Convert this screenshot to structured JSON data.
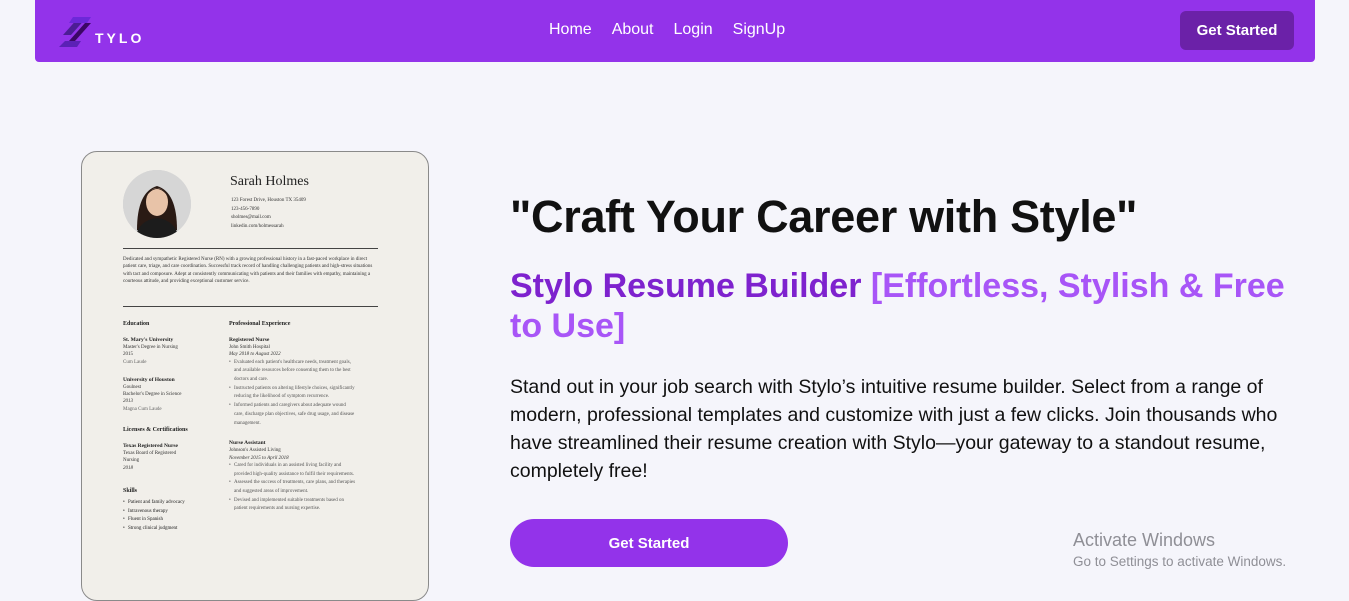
{
  "brand": {
    "name": "TYLO"
  },
  "nav": {
    "links": [
      "Home",
      "About",
      "Login",
      "SignUp"
    ],
    "cta": "Get Started"
  },
  "resume": {
    "name": "Sarah Holmes",
    "contact": [
      "123 Forest Drive, Houston TX 35409",
      "123-456-7890",
      "sholmes@mail.com",
      "linkedin.com/holmessarah"
    ],
    "summary": "Dedicated and sympathetic Registered Nurse (RN) with a growing professional history in a fast-paced workplace in direct patient care, triage, and care coordination. Successful track record of handling challenging patients and high-stress situations with tact and composure. Adept at consistently communicating with patients and their families with empathy, maintaining a courteous attitude, and providing exceptional customer service.",
    "education": {
      "heading": "Education",
      "items": [
        {
          "title": "St. Mary's University",
          "lines": [
            "Master's Degree in Nursing",
            "2015",
            "Cum Laude"
          ]
        },
        {
          "title": "University of Houston",
          "lines": [
            "Goulnest",
            "Bachelor's Degree in Science",
            "2013",
            "Magna Cum Laude"
          ]
        }
      ]
    },
    "licenses": {
      "heading": "Licenses & Certifications",
      "items": [
        {
          "title": "Texas Registered Nurse",
          "lines": [
            "Texas Board of Registered",
            "Nursing",
            "2018"
          ]
        }
      ]
    },
    "skills": {
      "heading": "Skills",
      "items": [
        "Patient and family advocacy",
        "Intravenous therapy",
        "Fluent in Spanish",
        "Strong clinical judgment"
      ]
    },
    "experience": {
      "heading": "Professional Experience",
      "jobs": [
        {
          "title": "Registered Nurse",
          "company": "John Smith Hospital",
          "dates": "May 2018 to August 2022",
          "bullets": [
            "Evaluated each patient's healthcare needs, treatment goals,",
            "and available resources before consenting them to the best",
            "doctors and care.",
            "Instructed patients on altering lifestyle choices, significantly",
            "reducing the likelihood of symptom recurrence.",
            "Informed patients and caregivers about adequate wound",
            "care, discharge plan objectives, safe drug usage, and disease",
            "management."
          ]
        },
        {
          "title": "Nurse Assistant",
          "company": "Johnson's Assisted Living",
          "dates": "November 2015 to April 2018",
          "bullets": [
            "Cared for individuals in an assisted living facility and",
            "provided high-quality assistance to fulfil their requirements.",
            "Assessed the success of treatments, care plans, and therapies",
            "and suggested areas of improvement.",
            "Devised and implemented suitable treatments based on",
            "patient requirements and nursing expertise."
          ]
        }
      ]
    }
  },
  "hero": {
    "title": "\"Craft Your Career with Style\"",
    "subtitle_main": "Stylo Resume Builder",
    "subtitle_accent": "[Effortless, Stylish & Free to Use]",
    "description": "Stand out in your job search with Stylo’s intuitive resume builder. Select from a range of modern, professional templates and customize with just a few clicks. Join thousands who have streamlined their resume creation with Stylo—your gateway to a standout resume, completely free!",
    "cta": "Get Started"
  },
  "watermark": {
    "title": "Activate Windows",
    "subtitle": "Go to Settings to activate Windows."
  },
  "colors": {
    "nav_bg": "#9333ea",
    "nav_cta_bg": "#6b21a8",
    "accent_dark": "#7e22ce",
    "accent_light": "#a855f7",
    "page_bg": "#f5f5fb"
  }
}
